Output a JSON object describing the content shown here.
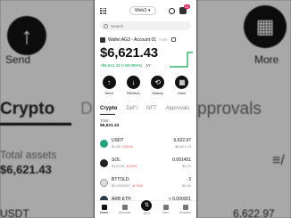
{
  "background": {
    "left": {
      "send_label": "Send",
      "tab_label": "Crypto",
      "partial_tab": "D",
      "total_label": "Total assets",
      "total_value": "$6,621.43",
      "partial_row": "USDT"
    },
    "right": {
      "more_label": "More",
      "tab_label": "pprovals",
      "partial_amount": "6,622.97"
    }
  },
  "header": {
    "network": "Web3",
    "notification_count": "43"
  },
  "search": {
    "placeholder": "Search"
  },
  "account": {
    "name": "Wallet AG3 - Account 01",
    "address": "7793"
  },
  "balance": {
    "value": "$6,621.43",
    "change": "+$6,621.43 (+99,999%)",
    "period": "1Y"
  },
  "actions": [
    {
      "label": "Send",
      "icon": "arrow-up-icon",
      "glyph": "↑"
    },
    {
      "label": "Receive",
      "icon": "arrow-down-icon",
      "glyph": "↓"
    },
    {
      "label": "History",
      "icon": "history-icon",
      "glyph": "⟲"
    },
    {
      "label": "More",
      "icon": "more-icon",
      "glyph": "▦"
    }
  ],
  "tabs": [
    "Crypto",
    "DeFi",
    "NFT",
    "Approvals"
  ],
  "total": {
    "label": "Total",
    "value": "$6,621.43"
  },
  "assets": [
    {
      "name": "USDT",
      "sub": "$1.00",
      "change": "-0.01%",
      "amount": "6,622.97",
      "value": "$6,621.43",
      "color": "#26a17b"
    },
    {
      "name": "SOL",
      "sub": "$142.35",
      "change": "-0.24%",
      "amount": "0.001451",
      "value": "$0.21",
      "color": "#222222"
    },
    {
      "name": "BTTOLD",
      "sub": "$0.0000007",
      "change": "-6.74%",
      "amount": "3",
      "value": "$0.00",
      "color": "#dddddd"
    },
    {
      "name": "ARB ETH",
      "sub": "$3,421.05",
      "change": "",
      "amount": "< 0.000001",
      "value": "",
      "color": "#2d374b"
    }
  ],
  "nav": [
    {
      "label": "Home",
      "icon": "home-icon",
      "active": true
    },
    {
      "label": "Discover",
      "icon": "discover-icon",
      "active": false
    },
    {
      "label": "DEX",
      "icon": "swap-icon",
      "active": false,
      "center": true
    },
    {
      "label": "Earn",
      "icon": "earn-icon",
      "active": false
    },
    {
      "label": "Browser",
      "icon": "browser-icon",
      "active": false
    }
  ],
  "colors": {
    "positive": "#11a055",
    "negative": "#e04848",
    "dark": "#111111"
  }
}
